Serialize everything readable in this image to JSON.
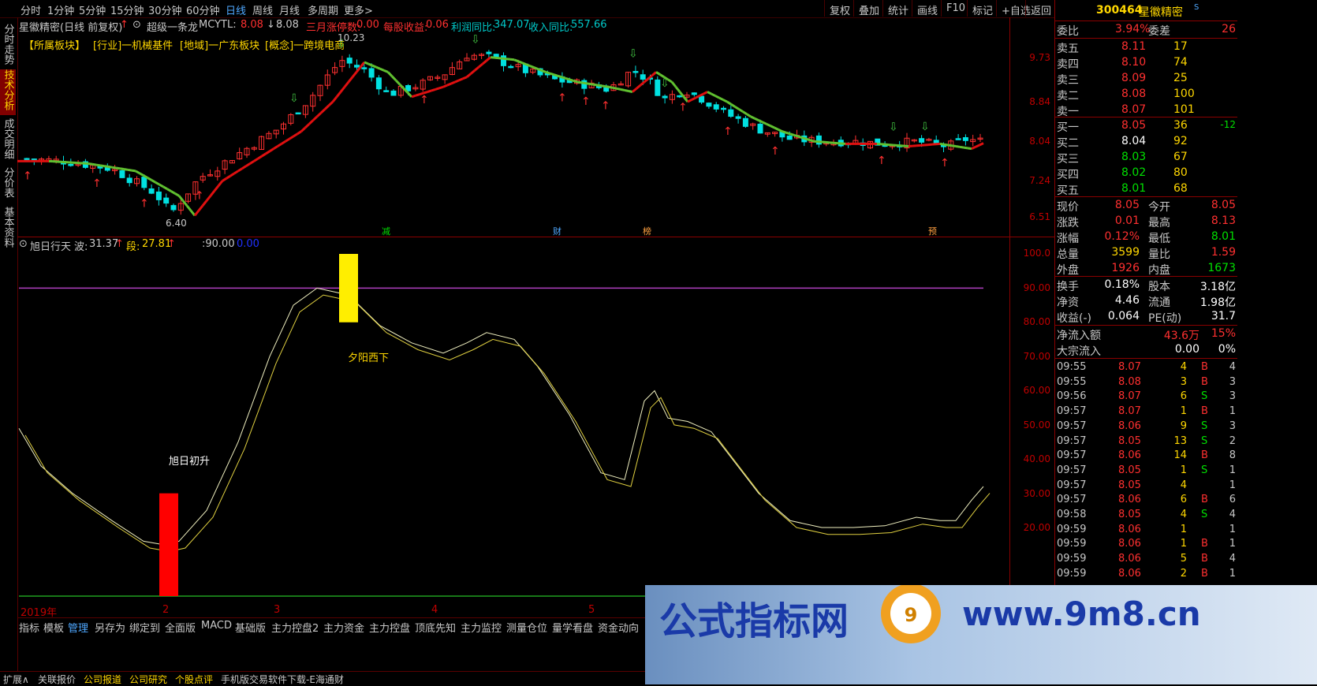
{
  "top_tabs": [
    "分时",
    "1分钟",
    "5分钟",
    "15分钟",
    "30分钟",
    "60分钟",
    "日线",
    "周线",
    "月线",
    "多周期",
    "更多>"
  ],
  "active_top_tab": "日线",
  "tool_buttons": [
    "复权",
    "叠加",
    "统计",
    "画线",
    "F10",
    "标记",
    "+自选",
    "返回"
  ],
  "vertical_tabs": [
    "分时走势",
    "技术分析",
    "成交明细",
    "分价表",
    "基本资料"
  ],
  "chart_header": {
    "title": "星徽精密(日线 前复权)",
    "indicator": "超级一条龙",
    "mcytl_label": "MCYTL: ",
    "mcytl_value": "8.08",
    "mcytl_value2": "8.08",
    "limit_label": "三月涨停数: ",
    "limit_value": "0.00",
    "eps_label": "每股收益: ",
    "eps_value": "0.06",
    "profit_label": "利润同比: ",
    "profit_value": "347.07",
    "revenue_label": "收入同比: ",
    "revenue_value": "557.66"
  },
  "sector_tags": [
    "【所属板块】",
    "[行业]一机械基件",
    "[地域]一广东板块",
    "[概念]一跨境电商"
  ],
  "price_labels": {
    "high": "10.23",
    "low": "6.40"
  },
  "event_marks": [
    "减",
    "财",
    "榜",
    "预"
  ],
  "price_axis": [
    "9.73",
    "8.84",
    "8.04",
    "7.24",
    "6.51"
  ],
  "sub_header": {
    "name": "旭日行天",
    "wave_label": "波: ",
    "wave_value": "31.37",
    "seg_label": "段: ",
    "seg_value": "27.81",
    "level_value": ":90.00",
    "zero_value": "0.00"
  },
  "sub_annotations": {
    "sunset": "夕阳西下",
    "sunrise": "旭日初升"
  },
  "sub_axis": [
    "100.0",
    "90.00",
    "80.00",
    "70.00",
    "60.00",
    "50.00",
    "40.00",
    "30.00",
    "20.00"
  ],
  "date_labels": [
    "2019年",
    "2",
    "3",
    "4",
    "5"
  ],
  "bottom_tabs": [
    "指标",
    "模板",
    "管理",
    "另存为",
    "绑定到",
    "全面版",
    "MACD",
    "基础版",
    "主力控盘2",
    "主力资金",
    "主力控盘",
    "顶底先知",
    "主力监控",
    "测量仓位",
    "量学看盘",
    "资金动向"
  ],
  "active_bottom_tab": "管理",
  "status_tabs": [
    "扩展∧",
    "关联报价",
    "公司报道",
    "公司研究",
    "个股点评",
    "手机版交易软件下载-E海通财"
  ],
  "quote": {
    "code": "300464",
    "name": "星徽精密",
    "weibi_label": "委比",
    "weibi": "3.94%",
    "weicha_label": "委差",
    "weicha": "26",
    "asks": [
      {
        "label": "卖五",
        "price": "8.11",
        "vol": "17"
      },
      {
        "label": "卖四",
        "price": "8.10",
        "vol": "74"
      },
      {
        "label": "卖三",
        "price": "8.09",
        "vol": "25"
      },
      {
        "label": "卖二",
        "price": "8.08",
        "vol": "100"
      },
      {
        "label": "卖一",
        "price": "8.07",
        "vol": "101"
      }
    ],
    "bids": [
      {
        "label": "买一",
        "price": "8.05",
        "vol": "36",
        "chg": "-12"
      },
      {
        "label": "买二",
        "price": "8.04",
        "vol": "92",
        "chg": ""
      },
      {
        "label": "买三",
        "price": "8.03",
        "vol": "67",
        "chg": ""
      },
      {
        "label": "买四",
        "price": "8.02",
        "vol": "80",
        "chg": ""
      },
      {
        "label": "买五",
        "price": "8.01",
        "vol": "68",
        "chg": ""
      }
    ],
    "stats": [
      {
        "l1": "现价",
        "v1": "8.05",
        "l2": "今开",
        "v2": "8.05",
        "c1": "#ff3030",
        "c2": "#ff3030"
      },
      {
        "l1": "涨跌",
        "v1": "0.01",
        "l2": "最高",
        "v2": "8.13",
        "c1": "#ff3030",
        "c2": "#ff3030"
      },
      {
        "l1": "涨幅",
        "v1": "0.12%",
        "l2": "最低",
        "v2": "8.01",
        "c1": "#ff3030",
        "c2": "#00e000"
      },
      {
        "l1": "总量",
        "v1": "3599",
        "l2": "量比",
        "v2": "1.59",
        "c1": "#ffd700",
        "c2": "#ff3030"
      },
      {
        "l1": "外盘",
        "v1": "1926",
        "l2": "内盘",
        "v2": "1673",
        "c1": "#ff3030",
        "c2": "#00e000"
      }
    ],
    "stats2": [
      {
        "l1": "换手",
        "v1": "0.18%",
        "l2": "股本",
        "v2": "3.18亿"
      },
      {
        "l1": "净资",
        "v1": "4.46",
        "l2": "流通",
        "v2": "1.98亿"
      },
      {
        "l1": "收益(-)",
        "v1": "0.064",
        "l2": "PE(动)",
        "v2": "31.7"
      }
    ],
    "flow": [
      {
        "label": "净流入额",
        "value": "43.6万",
        "pct": "15%",
        "vc": "#ff3030"
      },
      {
        "label": "大宗流入",
        "value": "0.00",
        "pct": "0%",
        "vc": "#ffffff"
      }
    ],
    "ticks": [
      {
        "t": "09:55",
        "p": "8.07",
        "v": "4",
        "bs": "B",
        "n": "4"
      },
      {
        "t": "09:55",
        "p": "8.08",
        "v": "3",
        "bs": "B",
        "n": "3"
      },
      {
        "t": "09:56",
        "p": "8.07",
        "v": "6",
        "bs": "S",
        "n": "3"
      },
      {
        "t": "09:57",
        "p": "8.07",
        "v": "1",
        "bs": "B",
        "n": "1"
      },
      {
        "t": "09:57",
        "p": "8.06",
        "v": "9",
        "bs": "S",
        "n": "3"
      },
      {
        "t": "09:57",
        "p": "8.05",
        "v": "13",
        "bs": "S",
        "n": "2"
      },
      {
        "t": "09:57",
        "p": "8.06",
        "v": "14",
        "bs": "B",
        "n": "8"
      },
      {
        "t": "09:57",
        "p": "8.05",
        "v": "1",
        "bs": "S",
        "n": "1"
      },
      {
        "t": "09:57",
        "p": "8.05",
        "v": "4",
        "bs": "",
        "n": "1"
      },
      {
        "t": "09:57",
        "p": "8.06",
        "v": "6",
        "bs": "B",
        "n": "6"
      },
      {
        "t": "09:58",
        "p": "8.05",
        "v": "4",
        "bs": "S",
        "n": "4"
      },
      {
        "t": "09:59",
        "p": "8.06",
        "v": "1",
        "bs": "",
        "n": "1"
      },
      {
        "t": "09:59",
        "p": "8.06",
        "v": "1",
        "bs": "B",
        "n": "1"
      },
      {
        "t": "09:59",
        "p": "8.06",
        "v": "5",
        "bs": "B",
        "n": "4"
      },
      {
        "t": "09:59",
        "p": "8.06",
        "v": "2",
        "bs": "B",
        "n": "1"
      }
    ]
  },
  "banner": {
    "cn": "公式指标网",
    "url": "www.9m8.cn"
  },
  "colors": {
    "up": "#ff3030",
    "down": "#00e0e0",
    "ma_up": "#e01010",
    "ma_down": "#60c030",
    "accent_blue": "#4fa8ff",
    "gold": "#ffd700"
  }
}
